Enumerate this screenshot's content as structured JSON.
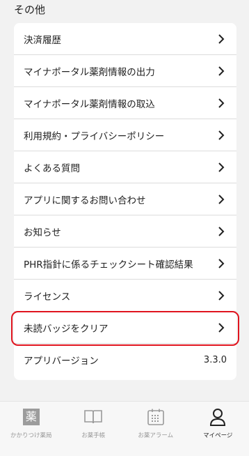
{
  "section": {
    "title": "その他"
  },
  "menu": {
    "items": [
      {
        "label": "決済履歴"
      },
      {
        "label": "マイナポータル薬剤情報の出力"
      },
      {
        "label": "マイナポータル薬剤情報の取込"
      },
      {
        "label": "利用規約・プライバシーポリシー"
      },
      {
        "label": "よくある質問"
      },
      {
        "label": "アプリに関するお問い合わせ"
      },
      {
        "label": "お知らせ"
      },
      {
        "label": "PHR指針に係るチェックシート確認結果"
      },
      {
        "label": "ライセンス"
      },
      {
        "label": "未読バッジをクリア"
      }
    ],
    "version": {
      "label": "アプリバージョン",
      "value": "3.3.0"
    }
  },
  "highlight_color": "#e0141e",
  "nav": {
    "items": [
      {
        "label": "かかりつけ薬局",
        "icon": "pharmacy-kanji-icon",
        "glyph": "薬"
      },
      {
        "label": "お薬手帳",
        "icon": "book-icon"
      },
      {
        "label": "お薬アラーム",
        "icon": "calendar-icon"
      },
      {
        "label": "マイページ",
        "icon": "person-icon",
        "active": true
      }
    ]
  }
}
